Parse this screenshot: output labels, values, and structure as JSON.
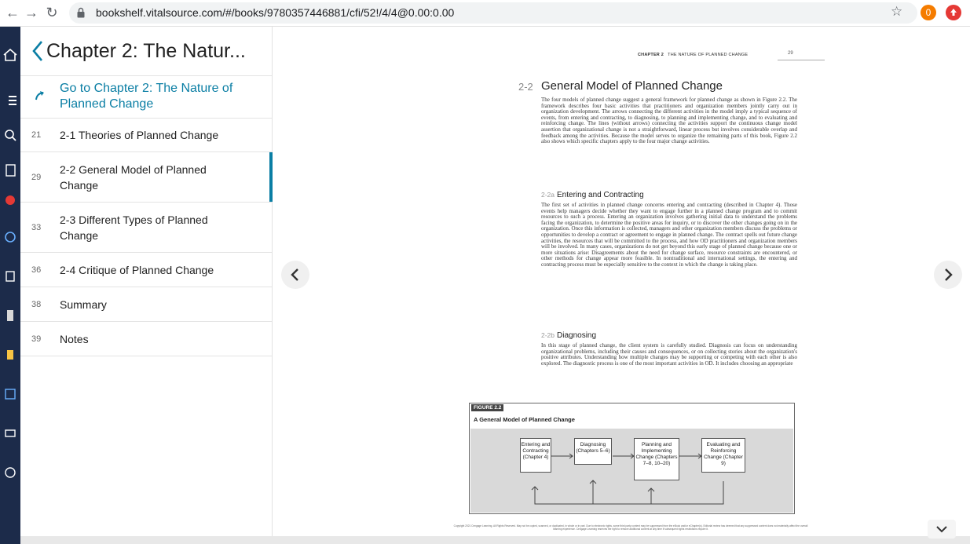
{
  "browser": {
    "url": "bookshelf.vitalsource.com/#/books/9780357446881/cfi/52!/4/4@0.00:0.00",
    "extension_badge": "0"
  },
  "sidebar": {
    "title": "Chapter 2: The Natur...",
    "go_to": "Go to Chapter 2: The Nature of Planned Change",
    "items": [
      {
        "page": "21",
        "label": "2-1 Theories of Planned Change"
      },
      {
        "page": "29",
        "label": "2-2 General Model of Planned Change"
      },
      {
        "page": "33",
        "label": "2-3 Different Types of Planned Change"
      },
      {
        "page": "36",
        "label": "2-4 Critique of Planned Change"
      },
      {
        "page": "38",
        "label": "Summary"
      },
      {
        "page": "39",
        "label": "Notes"
      }
    ]
  },
  "page": {
    "running_head_chapter": "CHAPTER 2",
    "running_head_title": "THE NATURE OF PLANNED CHANGE",
    "page_number": "29",
    "section_number": "2-2",
    "section_title": "General Model of Planned Change",
    "intro": "The four models of planned change suggest a general framework for planned change as shown in Figure 2.2. The framework describes four basic activities that practitioners and organization members jointly carry out in organization development. The arrows connecting the different activities in the model imply a typical sequence of events, from entering and contracting, to diagnosing, to planning and implementing change, and to evaluating and reinforcing change. The lines (without arrows) connecting the activities support the continuous change model assertion that organizational change is not a straightforward, linear process but involves considerable overlap and feedback among the activities. Because the model serves to organize the remaining parts of this book, Figure 2.2 also shows which specific chapters apply to the four major change activities.",
    "sub_a_number": "2-2a",
    "sub_a_title": "Entering and Contracting",
    "sub_a_text": "The first set of activities in planned change concerns entering and contracting (described in Chapter 4). Those events help managers decide whether they want to engage further in a planned change program and to commit resources to such a process. Entering an organization involves gathering initial data to understand the problems facing the organization, to determine the positive areas for inquiry, or to discover the other changes going on in the organization. Once this information is collected, managers and other organization members discuss the problems or opportunities to develop a contract or agreement to engage in planned change. The contract spells out future change activities, the resources that will be committed to the process, and how OD practitioners and organization members will be involved. In many cases, organizations do not get beyond this early stage of planned change because one or more situations arise: Disagreements about the need for change surface, resource constraints are encountered, or other methods for change appear more feasible. In nontraditional and international settings, the entering and contracting process must be especially sensitive to the context in which the change is taking place.",
    "sub_b_number": "2-2b",
    "sub_b_title": "Diagnosing",
    "sub_b_text": "In this stage of planned change, the client system is carefully studied. Diagnosis can focus on understanding organizational problems, including their causes and consequences, or on collecting stories about the organization's positive attributes. Understanding how multiple changes may be supporting or competing with each other is also explored. The diagnostic process is one of the most important activities in OD. It includes choosing an appropriate",
    "figure_label": "FIGURE 2.2",
    "figure_title": "A General Model of Planned Change",
    "figure_boxes": [
      "Entering and Contracting (Chapter 4)",
      "Diagnosing (Chapters 5–6)",
      "Planning and Implementing Change (Chapters 7–8, 10–20)",
      "Evaluating and Reinforcing Change (Chapter 9)"
    ],
    "copyright": "Copyright 2021 Cengage Learning. All Rights Reserved. May not be copied, scanned, or duplicated, in whole or in part. Due to electronic rights, some third party content may be suppressed from the eBook and/or eChapter(s). Editorial review has deemed that any suppressed content does not materially affect the overall learning experience. Cengage Learning reserves the right to remove additional content at any time if subsequent rights restrictions require it."
  }
}
